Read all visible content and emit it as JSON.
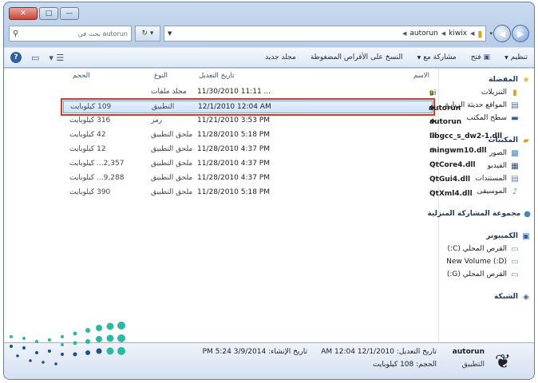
{
  "window": {
    "controls": {
      "close": "✕",
      "maximize": "□",
      "minimize": "—"
    }
  },
  "address": {
    "search_placeholder": "بحث في autorun",
    "path": [
      "kiwix",
      "autorun"
    ]
  },
  "toolbar": {
    "organize": "تنظيم",
    "open": "فتح",
    "share": "مشاركة مع",
    "burn": "النسخ على الأقراص المضغوطة",
    "new_folder": "مجلد جديد"
  },
  "sidebar": {
    "favorites": "المفضلة",
    "favorites_items": [
      "التنزيلات",
      "المواقع حديثة الزيارة",
      "سطح المكتب"
    ],
    "libraries": "المكتبات",
    "libraries_items": [
      "الصور",
      "الفيديو",
      "المستندات",
      "الموسيقى"
    ],
    "homegroup": "مجموعة المشاركة المنزلية",
    "computer": "الكمبيوتر",
    "computer_items": [
      "القرص المحلي (C:)",
      "(D:) New Volume",
      "القرص المحلي (G:)"
    ],
    "network": "الشبكة"
  },
  "columns": {
    "name": "الاسم",
    "date": "تاريخ التعديل",
    "type": "النوع",
    "size": "الحجم"
  },
  "files": [
    {
      "name": "ui",
      "date": "11/30/2010 11:11 ...",
      "type": "مجلد ملفات",
      "size": ""
    },
    {
      "name": "autorun",
      "date": "12/1/2010 12:04 AM",
      "type": "التطبيق",
      "size": "109 كيلوبايت"
    },
    {
      "name": "autorun",
      "date": "11/21/2010 3:53 PM",
      "type": "رمز",
      "size": "316 كيلوبايت"
    },
    {
      "name": "libgcc_s_dw2-1.dll",
      "date": "11/28/2010 5:18 PM",
      "type": "ملحق التطبيق",
      "size": "42 كيلوبايت"
    },
    {
      "name": "mingwm10.dll",
      "date": "11/28/2010 4:37 PM",
      "type": "ملحق التطبيق",
      "size": "12 كيلوبايت"
    },
    {
      "name": "QtCore4.dll",
      "date": "11/28/2010 4:37 PM",
      "type": "ملحق التطبيق",
      "size": "2,357... كيلوبايت"
    },
    {
      "name": "QtGui4.dll",
      "date": "11/28/2010 4:37 PM",
      "type": "ملحق التطبيق",
      "size": "9,288... كيلوبايت"
    },
    {
      "name": "QtXml4.dll",
      "date": "11/28/2010 5:18 PM",
      "type": "ملحق التطبيق",
      "size": "390 كيلوبايت"
    }
  ],
  "details": {
    "name": "autorun",
    "type": "التطبيق",
    "modified": "تاريخ التعديل: 12/1/2010 12:04 AM",
    "size": "الحجم: 108 كيلوبايت",
    "created": "تاريخ الإنشاء: 3/9/2014 5:24 PM"
  },
  "colors": {
    "selection_outline": "#d83a2a",
    "selection_fill": "#cde3fa",
    "logo_teal": "#2bb9a4",
    "logo_navy": "#1d4f91"
  }
}
